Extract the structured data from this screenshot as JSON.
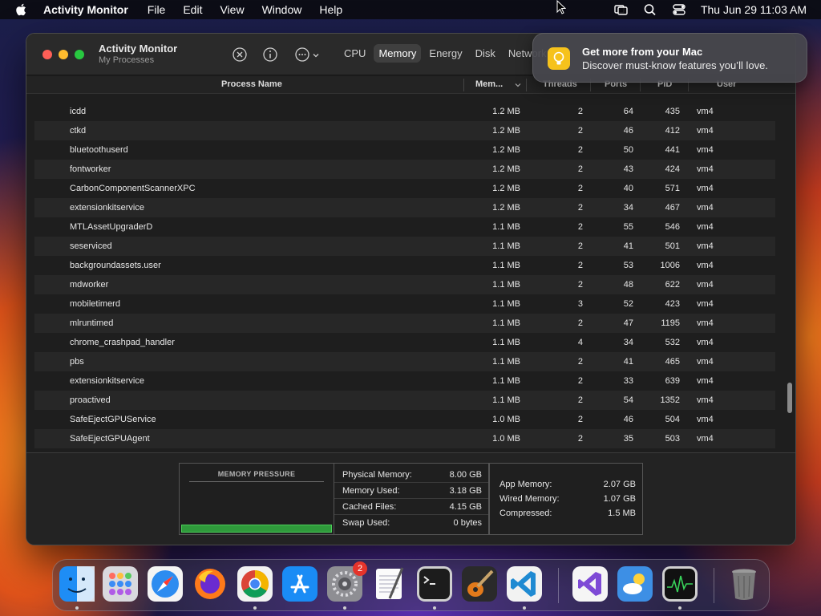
{
  "menubar": {
    "app_name": "Activity Monitor",
    "items": [
      "File",
      "Edit",
      "View",
      "Window",
      "Help"
    ],
    "clock": "Thu Jun 29  11:03 AM"
  },
  "window": {
    "title": "Activity Monitor",
    "subtitle": "My Processes",
    "tabs": [
      "CPU",
      "Memory",
      "Energy",
      "Disk",
      "Network"
    ],
    "active_tab": "Memory"
  },
  "table": {
    "headers": {
      "name": "Process Name",
      "memory": "Mem...",
      "threads": "Threads",
      "ports": "Ports",
      "pid": "PID",
      "user": "User"
    },
    "rows": [
      {
        "name": "icdd",
        "memory": "1.2 MB",
        "threads": "2",
        "ports": "64",
        "pid": "435",
        "user": "vm4"
      },
      {
        "name": "ctkd",
        "memory": "1.2 MB",
        "threads": "2",
        "ports": "46",
        "pid": "412",
        "user": "vm4"
      },
      {
        "name": "bluetoothuserd",
        "memory": "1.2 MB",
        "threads": "2",
        "ports": "50",
        "pid": "441",
        "user": "vm4"
      },
      {
        "name": "fontworker",
        "memory": "1.2 MB",
        "threads": "2",
        "ports": "43",
        "pid": "424",
        "user": "vm4"
      },
      {
        "name": "CarbonComponentScannerXPC",
        "memory": "1.2 MB",
        "threads": "2",
        "ports": "40",
        "pid": "571",
        "user": "vm4"
      },
      {
        "name": "extensionkitservice",
        "memory": "1.2 MB",
        "threads": "2",
        "ports": "34",
        "pid": "467",
        "user": "vm4"
      },
      {
        "name": "MTLAssetUpgraderD",
        "memory": "1.1 MB",
        "threads": "2",
        "ports": "55",
        "pid": "546",
        "user": "vm4"
      },
      {
        "name": "seserviced",
        "memory": "1.1 MB",
        "threads": "2",
        "ports": "41",
        "pid": "501",
        "user": "vm4"
      },
      {
        "name": "backgroundassets.user",
        "memory": "1.1 MB",
        "threads": "2",
        "ports": "53",
        "pid": "1006",
        "user": "vm4"
      },
      {
        "name": "mdworker",
        "memory": "1.1 MB",
        "threads": "2",
        "ports": "48",
        "pid": "622",
        "user": "vm4"
      },
      {
        "name": "mobiletimerd",
        "memory": "1.1 MB",
        "threads": "3",
        "ports": "52",
        "pid": "423",
        "user": "vm4"
      },
      {
        "name": "mlruntimed",
        "memory": "1.1 MB",
        "threads": "2",
        "ports": "47",
        "pid": "1195",
        "user": "vm4"
      },
      {
        "name": "chrome_crashpad_handler",
        "memory": "1.1 MB",
        "threads": "4",
        "ports": "34",
        "pid": "532",
        "user": "vm4"
      },
      {
        "name": "pbs",
        "memory": "1.1 MB",
        "threads": "2",
        "ports": "41",
        "pid": "465",
        "user": "vm4"
      },
      {
        "name": "extensionkitservice",
        "memory": "1.1 MB",
        "threads": "2",
        "ports": "33",
        "pid": "639",
        "user": "vm4"
      },
      {
        "name": "proactived",
        "memory": "1.1 MB",
        "threads": "2",
        "ports": "54",
        "pid": "1352",
        "user": "vm4"
      },
      {
        "name": "SafeEjectGPUService",
        "memory": "1.0 MB",
        "threads": "2",
        "ports": "46",
        "pid": "504",
        "user": "vm4"
      },
      {
        "name": "SafeEjectGPUAgent",
        "memory": "1.0 MB",
        "threads": "2",
        "ports": "35",
        "pid": "503",
        "user": "vm4"
      }
    ]
  },
  "memory_panel": {
    "pressure_title": "MEMORY PRESSURE",
    "pressure_level": 0.12,
    "physical_memory": {
      "label": "Physical Memory:",
      "value": "8.00 GB"
    },
    "memory_used": {
      "label": "Memory Used:",
      "value": "3.18 GB"
    },
    "cached_files": {
      "label": "Cached Files:",
      "value": "4.15 GB"
    },
    "swap_used": {
      "label": "Swap Used:",
      "value": "0 bytes"
    },
    "app_memory": {
      "label": "App Memory:",
      "value": "2.07 GB"
    },
    "wired_memory": {
      "label": "Wired Memory:",
      "value": "1.07 GB"
    },
    "compressed": {
      "label": "Compressed:",
      "value": "1.5 MB"
    }
  },
  "notification": {
    "title": "Get more from your Mac",
    "body": "Discover must-know features you’ll love."
  },
  "dock": {
    "apps": [
      "finder",
      "launchpad",
      "safari",
      "firefox",
      "chrome",
      "app-store",
      "system-settings",
      "textedit",
      "terminal",
      "garageband",
      "vscode",
      "visual-studio",
      "weather",
      "activity-monitor",
      "trash"
    ],
    "settings_badge": "2"
  },
  "colors": {
    "accent_green": "#2f9a3b",
    "badge_red": "#e5342b",
    "window_bg": "#1e1e1e"
  }
}
